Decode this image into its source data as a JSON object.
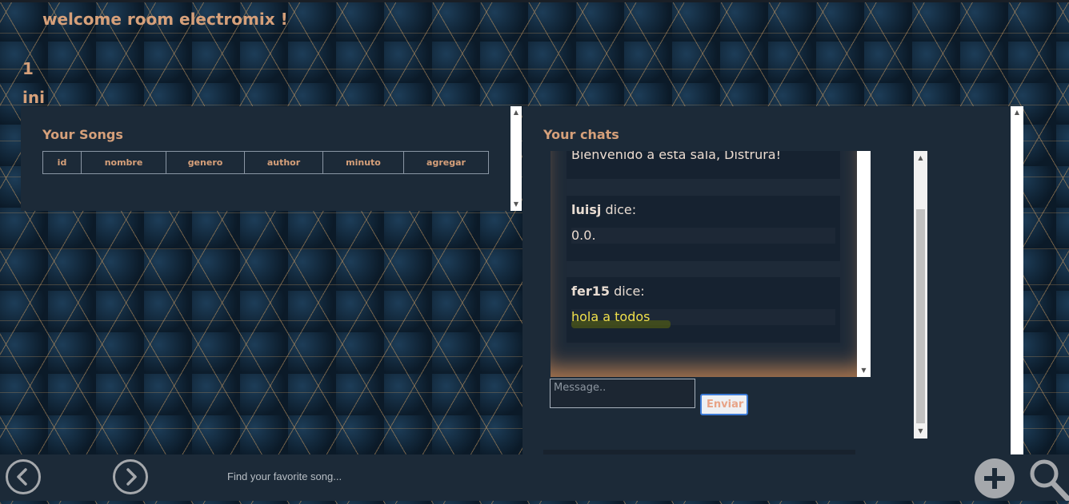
{
  "header": {
    "welcome": "welcome room electromix !",
    "counter": "1",
    "status": "ini"
  },
  "songs": {
    "title": "Your Songs",
    "columns": [
      "id",
      "nombre",
      "genero",
      "author",
      "minuto",
      "agregar"
    ]
  },
  "chats": {
    "title": "Your chats",
    "messages": [
      {
        "body": "Bienvenido a esta sala, Distrura!"
      },
      {
        "user": "luisj",
        "verb": "dice:",
        "body": "0.0."
      },
      {
        "user": "fer15",
        "verb": "dice:",
        "body": "hola a todos"
      }
    ],
    "input_placeholder": "Message..",
    "send_label": "Enviar"
  },
  "footer": {
    "search_placeholder": "Find your favorite song...",
    "icons": [
      "back-icon",
      "forward-icon",
      "add-icon",
      "search-icon"
    ]
  },
  "colors": {
    "accent": "#d6a07a",
    "panel": "#1c2a38",
    "send_border": "#3d7bd6",
    "highlight": "#f0e04a"
  }
}
